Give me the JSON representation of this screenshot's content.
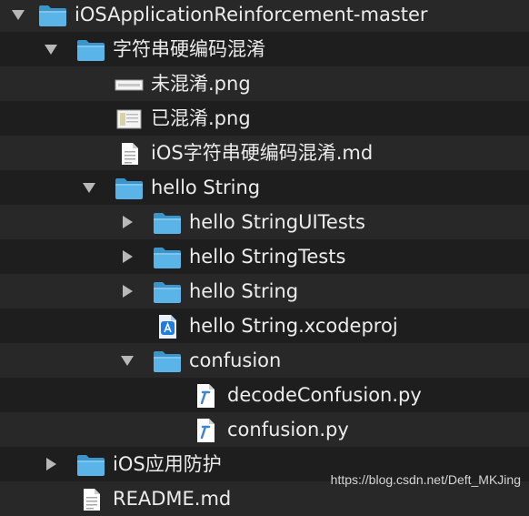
{
  "tree": {
    "root": {
      "label": "iOSApplicationReinforcement-master",
      "icon": "folder-icon",
      "expanded": true
    },
    "obfuscation_folder": {
      "label": "字符串硬编码混淆",
      "icon": "folder-icon",
      "expanded": true
    },
    "unobfuscated_png": {
      "label": "未混淆.png",
      "icon": "image-file-icon"
    },
    "obfuscated_png": {
      "label": "已混淆.png",
      "icon": "image-file-icon"
    },
    "readme_md": {
      "label": "iOS字符串硬编码混淆.md",
      "icon": "text-file-icon"
    },
    "hello_string_folder": {
      "label": "hello String",
      "icon": "folder-icon",
      "expanded": true
    },
    "ui_tests_folder": {
      "label": "hello StringUITests",
      "icon": "folder-icon",
      "expanded": false
    },
    "tests_folder": {
      "label": "hello StringTests",
      "icon": "folder-icon",
      "expanded": false
    },
    "app_folder": {
      "label": "hello String",
      "icon": "folder-icon",
      "expanded": false
    },
    "xcodeproj": {
      "label": "hello String.xcodeproj",
      "icon": "xcode-project-icon"
    },
    "confusion_folder": {
      "label": "confusion",
      "icon": "folder-icon",
      "expanded": true
    },
    "decode_py": {
      "label": "decodeConfusion.py",
      "icon": "python-file-icon"
    },
    "confusion_py": {
      "label": "confusion.py",
      "icon": "python-file-icon"
    },
    "protection_folder": {
      "label": "iOS应用防护",
      "icon": "folder-icon",
      "expanded": false
    },
    "readme_partial": {
      "label": "README.md",
      "icon": "text-file-icon"
    }
  },
  "watermark": "https://blog.csdn.net/Deft_MKJing",
  "colors": {
    "background": "#1e1e1e",
    "row_alternate": "#282828",
    "folder_blue": "#5ab4e8",
    "folder_dark": "#3d94c8",
    "text": "#ececec"
  }
}
